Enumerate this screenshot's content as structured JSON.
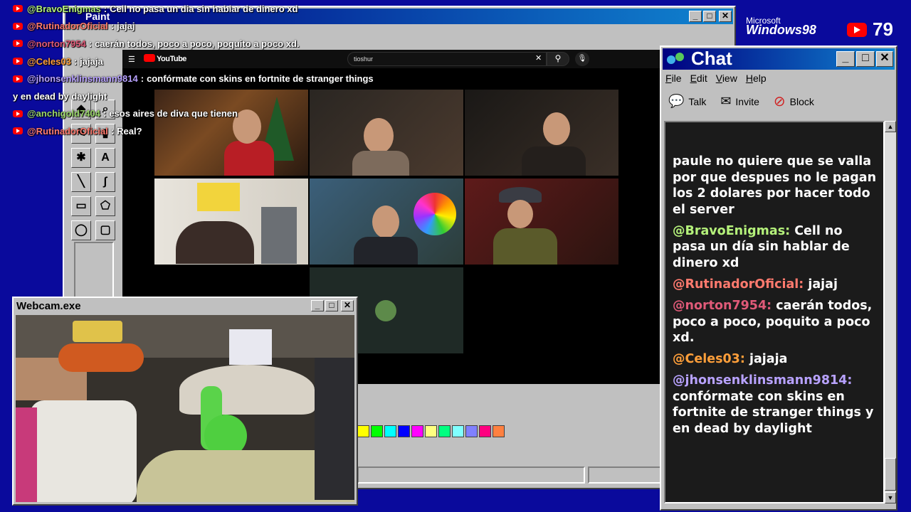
{
  "overlay_chat": [
    {
      "user": "@BravoEnigmas",
      "user_color": "#b5f27b",
      "text": "Cell no pasa un dia sin hablar de dinero xd"
    },
    {
      "user": "@RutinadorOficial",
      "user_color": "#ff7a6e",
      "text": "jajaj"
    },
    {
      "user": "@norton7954",
      "user_color": "#e05a78",
      "text": "caerán todos, poco a poco, poquito a poco xd."
    },
    {
      "user": "@Celes03",
      "user_color": "#ff9f3a",
      "text": "jajaja"
    },
    {
      "user": "@jhonsenklinsmann9814",
      "user_color": "#b8a2ff",
      "text": "confórmate con skins en fortnite de stranger things"
    },
    {
      "continuation": "y en dead by daylight"
    },
    {
      "user": "@anchigold7404",
      "user_color": "#9ad66a",
      "text": "esos aires de diva que tienen"
    },
    {
      "user": "@RutinadorOficial",
      "user_color": "#ff7a6e",
      "text": "Real?"
    }
  ],
  "paint_window": {
    "title": "Paint"
  },
  "youtube": {
    "logo_text": "YouTube",
    "search_value": "tioshur",
    "search_icon": "search-icon",
    "mic_icon": "mic-icon"
  },
  "webcam_window": {
    "title": "Webcam.exe"
  },
  "branding": {
    "microsoft": "Microsoft",
    "windows": "Windows98",
    "viewers": "79"
  },
  "chat_window": {
    "title": "Chat",
    "menu": [
      "File",
      "Edit",
      "View",
      "Help"
    ],
    "tools": [
      {
        "label": "Talk",
        "icon": "talk-icon"
      },
      {
        "label": "Invite",
        "icon": "invite-icon"
      },
      {
        "label": "Block",
        "icon": "block-icon"
      }
    ],
    "messages": [
      {
        "user": "",
        "text": "paule no quiere que se valla por que despues no le pagan los 2 dolares por hacer todo el server"
      },
      {
        "user": "@BravoEnigmas:",
        "user_color": "#b5f27b",
        "text": "Cell no pasa un día sin hablar de dinero xd"
      },
      {
        "user": "@RutinadorOficial:",
        "user_color": "#ff7a6e",
        "text": "jajaj"
      },
      {
        "user": "@norton7954:",
        "user_color": "#e05a78",
        "text": "caerán todos, poco a poco, poquito a poco xd."
      },
      {
        "user": "@Celes03:",
        "user_color": "#ff9f3a",
        "text": "jajaja"
      },
      {
        "user": "@jhonsenklinsmann9814:",
        "user_color": "#b8a2ff",
        "text": "confórmate con skins en fortnite de stranger things y en dead by daylight"
      }
    ]
  },
  "palette_colors": [
    "#ffff00",
    "#00ff00",
    "#00ffff",
    "#0000ff",
    "#ff00ff",
    "#ffff80",
    "#00ff80",
    "#80ffff",
    "#8080ff",
    "#ff0080",
    "#ff8040"
  ]
}
